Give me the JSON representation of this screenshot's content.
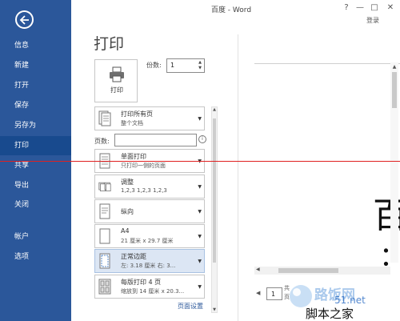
{
  "window": {
    "title": "百度 - Word",
    "help": "?",
    "minimize": "—",
    "maximize": "□",
    "close": "✕",
    "signin": "登录"
  },
  "sidebar": {
    "items": [
      {
        "label": "信息"
      },
      {
        "label": "新建"
      },
      {
        "label": "打开"
      },
      {
        "label": "保存"
      },
      {
        "label": "另存为"
      },
      {
        "label": "打印",
        "active": true
      },
      {
        "label": "共享"
      },
      {
        "label": "导出"
      },
      {
        "label": "关闭"
      },
      {
        "label": "帐户"
      },
      {
        "label": "选项"
      }
    ]
  },
  "print": {
    "title": "打印",
    "button_label": "打印",
    "copies_label": "份数:",
    "copies_value": "1",
    "pages_label": "页数:",
    "pages_value": "",
    "page_setup": "页面设置",
    "settings": [
      {
        "main": "打印所有页",
        "sub": "整个文档",
        "icon": "pages-icon"
      },
      {
        "main": "单面打印",
        "sub": "只打印一侧的页面",
        "icon": "one-sided-icon"
      },
      {
        "main": "调整",
        "sub": "1,2,3    1,2,3    1,2,3",
        "icon": "collate-icon"
      },
      {
        "main": "纵向",
        "sub": "",
        "icon": "portrait-icon"
      },
      {
        "main": "A4",
        "sub": "21 厘米 x 29.7 厘米",
        "icon": "paper-size-icon"
      },
      {
        "main": "正常边距",
        "sub": "左: 3.18 厘米   右: 3...",
        "icon": "margins-icon"
      },
      {
        "main": "每版打印 4 页",
        "sub": "缩放到 14 厘米 x 20.3...",
        "icon": "pages-per-sheet-icon"
      }
    ]
  },
  "preview": {
    "big_char": "百",
    "small_char": "：",
    "page_number": "1",
    "page_of": "共\n页"
  },
  "watermark": {
    "brand": "路饭网",
    "site": "51.net",
    "sub": "脚本之家"
  },
  "colors": {
    "sidebar": "#2b579a",
    "sidebar_active": "#184a8e",
    "annotation": "#e02020"
  }
}
